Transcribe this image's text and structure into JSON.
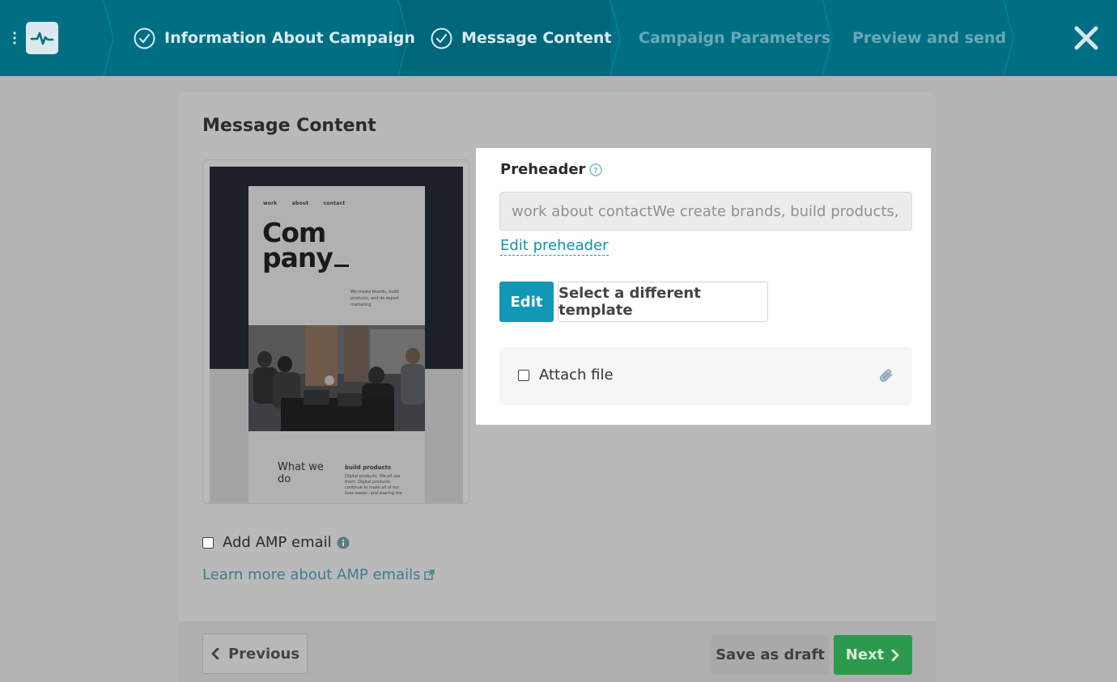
{
  "header": {
    "steps": [
      {
        "label": "Information About Campaign",
        "state": "done"
      },
      {
        "label": "Message Content",
        "state": "active"
      },
      {
        "label": "Campaign Parameters",
        "state": "todo"
      },
      {
        "label": "Preview and send",
        "state": "todo"
      }
    ],
    "icons": {
      "menu": "vertical-dots-icon",
      "logo": "pulse-logo-icon",
      "close": "close-icon",
      "step_done": "check-circle-icon"
    }
  },
  "main": {
    "title": "Message Content",
    "preview": {
      "nav": [
        "work",
        "about",
        "contact"
      ],
      "logo_line1": "Com",
      "logo_line2": "pany",
      "tagline": "We create brands, build products, and do expert marketing",
      "section_title_line1": "What we",
      "section_title_line2": "do",
      "feature_title": "build products",
      "feature_text": "Digital products. We all use them. Digital products continue to make all of our lives easier, and sharing the"
    },
    "amp": {
      "checkbox_label": "Add AMP email",
      "learn_more": "Learn more about AMP emails"
    },
    "preheader": {
      "label": "Preheader",
      "value": "work about contactWe create brands, build products, and do expert marketing",
      "edit_link": "Edit preheader"
    },
    "buttons": {
      "edit": "Edit",
      "select_template": "Select a different template"
    },
    "attach": {
      "label": "Attach file"
    }
  },
  "footer": {
    "previous": "Previous",
    "save_draft": "Save as draft",
    "next": "Next"
  },
  "colors": {
    "header_bg": "#006f84",
    "accent": "#1298b6",
    "next_green": "#2c9a4c"
  }
}
